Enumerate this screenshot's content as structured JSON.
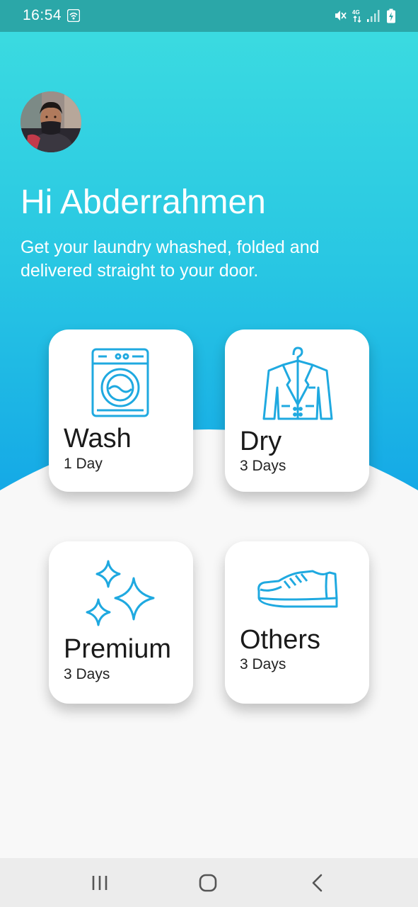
{
  "status": {
    "time": "16:54",
    "icons": [
      "wifi-status-icon",
      "mute-icon",
      "4g-signal-icon",
      "signal-bars-icon",
      "battery-charging-icon"
    ]
  },
  "user": {
    "greeting": "Hi Abderrahmen",
    "subtitle": "Get your laundry whashed, folded and delivered straight to your door."
  },
  "services": [
    {
      "title": "Wash",
      "duration": "1 Day",
      "icon": "washing-machine-icon"
    },
    {
      "title": "Dry",
      "duration": "3 Days",
      "icon": "suit-hanger-icon"
    },
    {
      "title": "Premium",
      "duration": "3 Days",
      "icon": "sparkles-icon"
    },
    {
      "title": "Others",
      "duration": "3 Days",
      "icon": "sneaker-icon"
    }
  ],
  "navigation": {
    "buttons": [
      "recent-apps-icon",
      "home-icon",
      "back-icon"
    ]
  },
  "colors": {
    "gradient_top": "#3ddde0",
    "gradient_bottom": "#12a6e6",
    "icon_blue": "#1fa9e0",
    "status_bar": "#2ba7a8",
    "background": "#f8f8f8"
  }
}
